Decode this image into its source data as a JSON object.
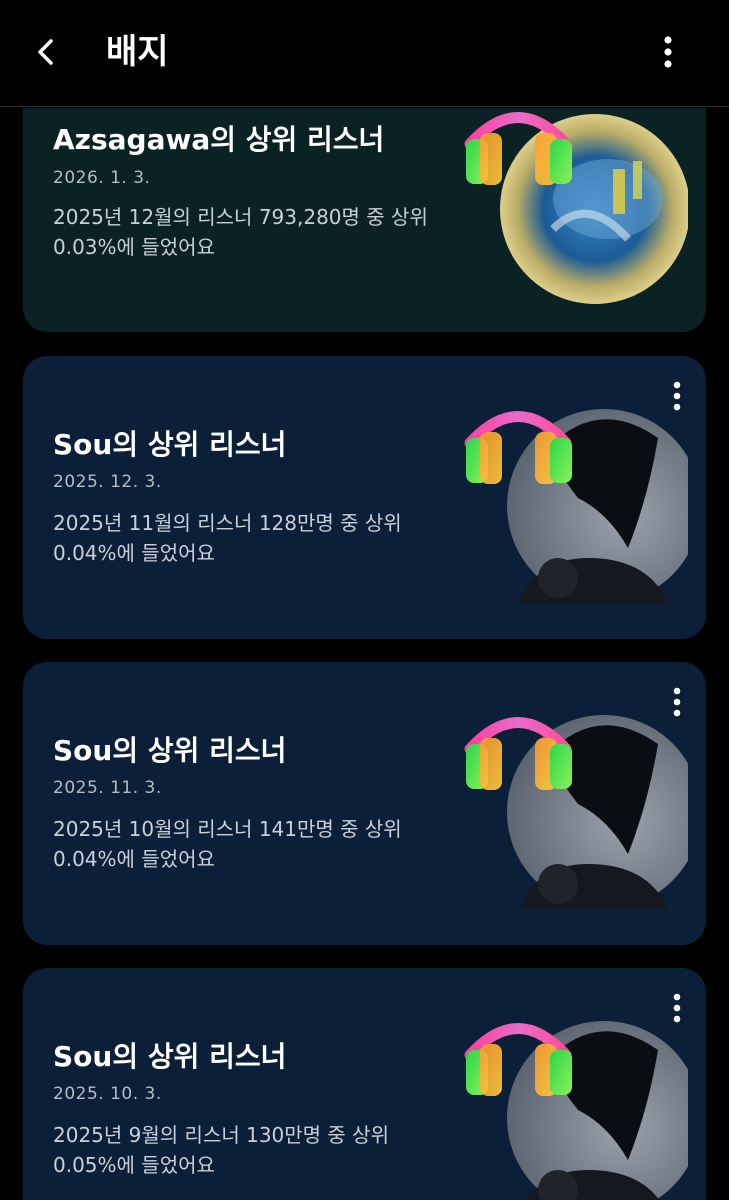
{
  "header": {
    "title": "배지",
    "back_icon": "chevron-left-icon",
    "more_icon": "vertical-dots-icon"
  },
  "colors": {
    "background": "#000000",
    "card_teal": "#0a2223",
    "card_navy": "#0c1f38",
    "text_primary": "#ffffff",
    "text_secondary": "#b4bcc6"
  },
  "badges": [
    {
      "title": "Azsagawa의 상위 리스너",
      "date": "2026. 1. 3.",
      "description": "2025년 12월의 리스너 793,280명 중 상위 0.03%에 들었어요"
    },
    {
      "title": "Sou의 상위 리스너",
      "date": "2025. 12. 3.",
      "description": "2025년 11월의 리스너 128만명 중 상위 0.04%에 들었어요"
    },
    {
      "title": "Sou의 상위 리스너",
      "date": "2025. 11. 3.",
      "description": "2025년 10월의 리스너 141만명 중 상위 0.04%에 들었어요"
    },
    {
      "title": "Sou의 상위 리스너",
      "date": "2025. 10. 3.",
      "description": "2025년 9월의 리스너 130만명 중 상위 0.05%에 들었어요"
    }
  ]
}
